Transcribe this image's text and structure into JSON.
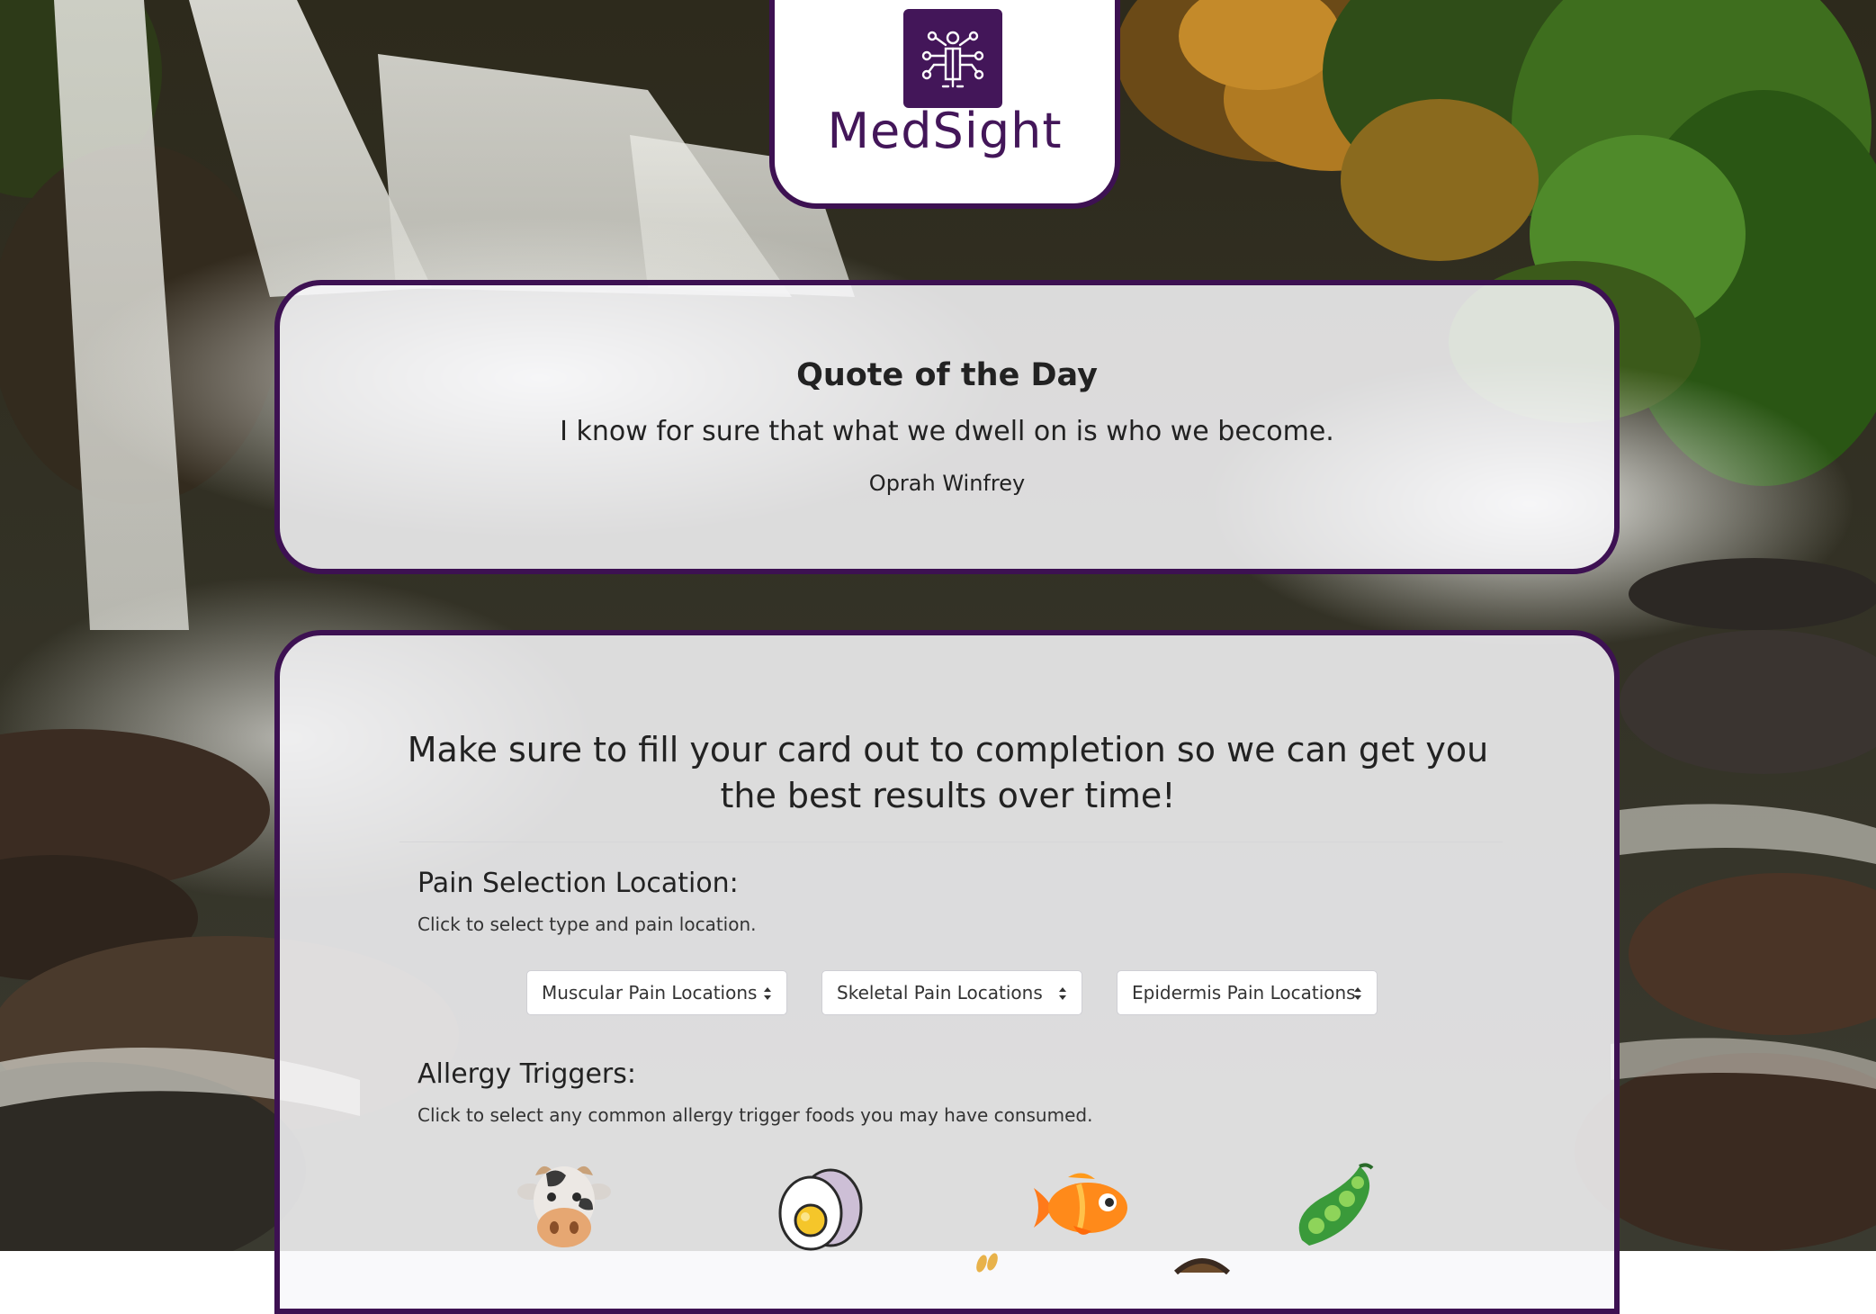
{
  "brand": {
    "name": "MedSight",
    "accent": "#431659"
  },
  "quote": {
    "title": "Quote of the Day",
    "text": "I know for sure that what we dwell on is who we become.",
    "author": "Oprah Winfrey"
  },
  "form": {
    "heading": "Make sure to fill your card out to completion so we can get you the best results over time!",
    "pain": {
      "title": "Pain Selection Location:",
      "subtitle": "Click to select type and pain location.",
      "selects": [
        {
          "value": "Muscular Pain Locations"
        },
        {
          "value": "Skeletal Pain Locations"
        },
        {
          "value": "Epidermis Pain Locations"
        }
      ]
    },
    "allergy": {
      "title": "Allergy Triggers:",
      "subtitle": "Click to select any common allergy trigger foods you may have consumed.",
      "foods": [
        {
          "icon": "cow-icon"
        },
        {
          "icon": "egg-icon"
        },
        {
          "icon": "fish-icon"
        },
        {
          "icon": "soybean-icon"
        },
        {
          "icon": "wheat-icon"
        },
        {
          "icon": "nut-icon"
        }
      ]
    }
  }
}
